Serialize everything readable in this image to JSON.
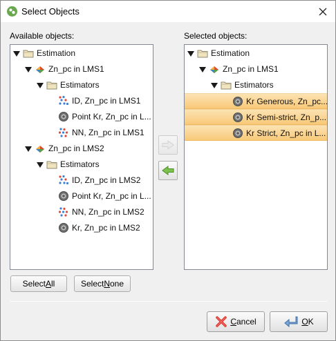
{
  "window": {
    "title": "Select Objects"
  },
  "available": {
    "label": "Available objects:",
    "label_access_key": "v",
    "rows": [
      {
        "text": "Estimation",
        "icon": "folder-icon",
        "level": 0,
        "expanded": true
      },
      {
        "text": "Zn_pc in LMS1",
        "icon": "estimation-surface-icon",
        "level": 1,
        "expanded": true
      },
      {
        "text": "Estimators",
        "icon": "folder-icon",
        "level": 2,
        "expanded": true
      },
      {
        "text": "ID, Zn_pc in LMS1",
        "icon": "idw-estimator-icon",
        "level": 3
      },
      {
        "text": "Point Kr, Zn_pc in L...",
        "icon": "kriging-estimator-icon",
        "level": 3
      },
      {
        "text": "NN, Zn_pc in LMS1",
        "icon": "nn-estimator-icon",
        "level": 3
      },
      {
        "text": "Zn_pc in LMS2",
        "icon": "estimation-surface-icon",
        "level": 1,
        "expanded": true
      },
      {
        "text": "Estimators",
        "icon": "folder-icon",
        "level": 2,
        "expanded": true
      },
      {
        "text": "ID, Zn_pc in LMS2",
        "icon": "idw-estimator-icon",
        "level": 3
      },
      {
        "text": "Point Kr, Zn_pc in L...",
        "icon": "kriging-estimator-icon",
        "level": 3
      },
      {
        "text": "NN, Zn_pc in LMS2",
        "icon": "nn-estimator-icon",
        "level": 3
      },
      {
        "text": "Kr, Zn_pc in LMS2",
        "icon": "kriging-estimator-icon",
        "level": 3
      }
    ]
  },
  "selected": {
    "label": "Selected objects:",
    "label_access_key": "e",
    "rows": [
      {
        "text": "Estimation",
        "icon": "folder-icon",
        "level": 0,
        "expanded": true
      },
      {
        "text": "Zn_pc in LMS1",
        "icon": "estimation-surface-icon",
        "level": 1,
        "expanded": true
      },
      {
        "text": "Estimators",
        "icon": "folder-icon",
        "level": 2,
        "expanded": true
      },
      {
        "text": "Kr Generous, Zn_pc...",
        "icon": "kriging-estimator-icon",
        "level": 3,
        "selected": true
      },
      {
        "text": "Kr Semi-strict, Zn_p...",
        "icon": "kriging-estimator-icon",
        "level": 3,
        "selected": true
      },
      {
        "text": "Kr Strict, Zn_pc in L...",
        "icon": "kriging-estimator-icon",
        "level": 3,
        "selected": true
      }
    ]
  },
  "buttons": {
    "select_all_pre": "Select ",
    "select_all_key": "A",
    "select_all_post": "ll",
    "select_none_pre": "Select ",
    "select_none_key": "N",
    "select_none_post": "one",
    "cancel_key": "C",
    "cancel_post": "ancel",
    "ok_key": "O",
    "ok_post": "K",
    "move_right_icon": "arrow-right-icon",
    "move_left_icon": "arrow-left-icon"
  },
  "colors": {
    "selection_top": "#fce3b3",
    "selection_bottom": "#f8c978",
    "arrow_green": "#6ab04c",
    "folder": "#e8d9a8"
  }
}
